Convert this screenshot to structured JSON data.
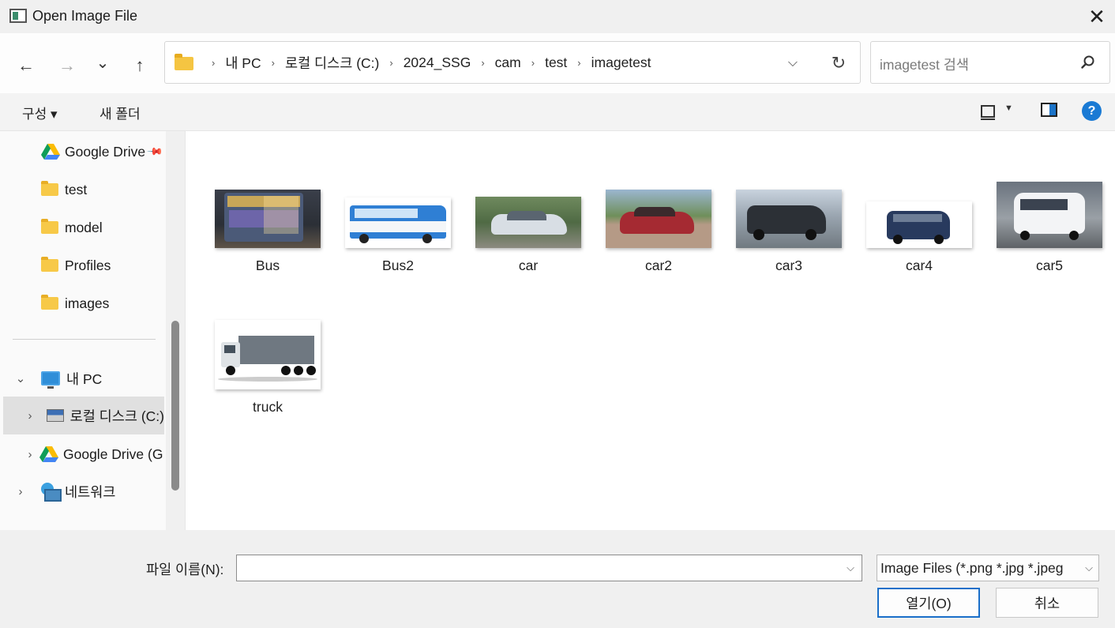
{
  "window": {
    "title": "Open Image File",
    "close_symbol": "✕"
  },
  "nav": {
    "back_symbol": "←",
    "forward_symbol": "→",
    "recent_symbol": "⌄",
    "up_symbol": "↑",
    "breadcrumbs": [
      "내 PC",
      "로컬 디스크 (C:)",
      "2024_SSG",
      "cam",
      "test",
      "imagetest"
    ],
    "breadcrumb_sep": "›",
    "dropdown_symbol": "⌵",
    "refresh_symbol": "↻",
    "search_placeholder": "imagetest 검색",
    "search_icon": "search-icon"
  },
  "commandbar": {
    "organize_label": "구성 ▾",
    "new_folder_label": "새 폴더",
    "view_caret": "▼",
    "help_label": "?"
  },
  "sidebar": {
    "items": [
      {
        "label": "Google Drive",
        "icon": "google-drive-icon"
      },
      {
        "label": "test",
        "icon": "folder-icon"
      },
      {
        "label": "model",
        "icon": "folder-icon"
      },
      {
        "label": "Profiles",
        "icon": "folder-icon"
      },
      {
        "label": "images",
        "icon": "folder-icon"
      },
      {
        "label": "내 PC",
        "icon": "pc-icon"
      },
      {
        "label": "로컬 디스크 (C:)",
        "icon": "disk-icon"
      },
      {
        "label": "Google Drive (G:)",
        "icon": "google-drive-icon"
      },
      {
        "label": "네트워크",
        "icon": "network-icon"
      }
    ],
    "expand_open": "⌄",
    "expand_closed": "›"
  },
  "files": [
    {
      "name": "Bus"
    },
    {
      "name": "Bus2"
    },
    {
      "name": "car"
    },
    {
      "name": "car2"
    },
    {
      "name": "car3"
    },
    {
      "name": "car4"
    },
    {
      "name": "car5"
    },
    {
      "name": "truck"
    }
  ],
  "footer": {
    "filename_label": "파일 이름(N):",
    "filename_value": "",
    "filetype_label": "Image Files (*.png *.jpg *.jpeg",
    "dropdown_symbol": "⌵",
    "open_label": "열기(O)",
    "cancel_label": "취소"
  },
  "colors": {
    "accent": "#1a7ad4",
    "folder": "#f7c948",
    "selected_bg": "#e0e0e0"
  }
}
